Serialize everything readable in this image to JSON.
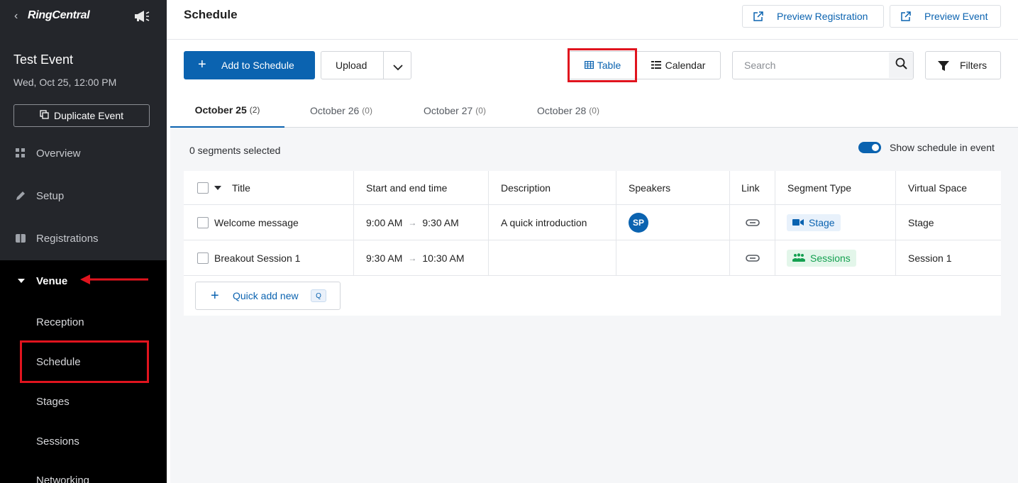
{
  "sidebar": {
    "logo": "RingCentral",
    "event_title": "Test Event",
    "event_date": "Wed, Oct 25, 12:00 PM",
    "duplicate_label": "Duplicate Event",
    "nav": [
      {
        "label": "Overview",
        "icon": "grid-icon"
      },
      {
        "label": "Setup",
        "icon": "pencil-icon"
      },
      {
        "label": "Registrations",
        "icon": "ticket-icon"
      }
    ],
    "venue": {
      "label": "Venue",
      "items": [
        "Reception",
        "Schedule",
        "Stages",
        "Sessions",
        "Networking"
      ]
    }
  },
  "header": {
    "title": "Schedule",
    "preview_registration": "Preview Registration",
    "preview_event": "Preview Event"
  },
  "toolbar": {
    "add_label": "Add to Schedule",
    "upload_label": "Upload",
    "table_label": "Table",
    "calendar_label": "Calendar",
    "search_placeholder": "Search",
    "filters_label": "Filters"
  },
  "tabs": [
    {
      "label": "October 25",
      "count": "(2)"
    },
    {
      "label": "October 26",
      "count": "(0)"
    },
    {
      "label": "October 27",
      "count": "(0)"
    },
    {
      "label": "October 28",
      "count": "(0)"
    }
  ],
  "content": {
    "selected_text": "0 segments selected",
    "show_schedule_label": "Show schedule in event"
  },
  "table": {
    "columns": [
      "Title",
      "Start and end time",
      "Description",
      "Speakers",
      "Link",
      "Segment Type",
      "Virtual Space"
    ],
    "rows": [
      {
        "title": "Welcome message",
        "start": "9:00 AM",
        "end": "9:30 AM",
        "description": "A quick introduction",
        "speaker": "SP",
        "segment_type": "Stage",
        "virtual_space": "Stage"
      },
      {
        "title": "Breakout Session 1",
        "start": "9:30 AM",
        "end": "10:30 AM",
        "description": "",
        "speaker": "",
        "segment_type": "Sessions",
        "virtual_space": "Session 1"
      }
    ],
    "quick_add_label": "Quick add new",
    "quick_add_shortcut": "Q"
  },
  "colors": {
    "primary": "#0b63b0",
    "highlight": "#e0141e",
    "sidebar_bg": "#24262b",
    "sessions_green": "#14a050"
  }
}
